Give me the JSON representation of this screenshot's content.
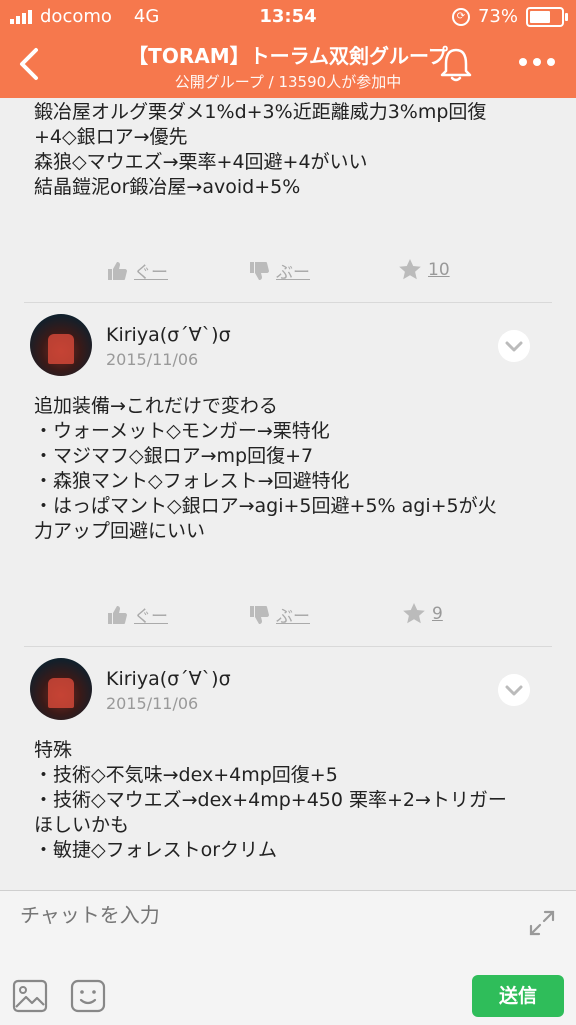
{
  "status_bar": {
    "carrier": "docomo",
    "network": "4G",
    "time": "13:54",
    "battery": "73%",
    "battery_level": 0.73
  },
  "header": {
    "title": "【TORAM】トーラム双剣グループ",
    "subtitle": "公開グループ / 13590人が参加中",
    "background": "#f6784d"
  },
  "posts": [
    {
      "text": "鍛冶屋オルグ栗ダメ1%d+3%近距離威力3%mp回復\n+4◇銀ロア→優先\n森狼◇マウエズ→栗率+4回避+4がいい\n結晶鎧泥or鍛冶屋→avoid+5%",
      "like_label": "ぐー",
      "dislike_label": "ぶー",
      "star_count": "10"
    },
    {
      "author": "Kiriya(σ´∀`)σ",
      "date": "2015/11/06",
      "text": "追加装備→これだけで変わる\n・ウォーメット◇モンガー→栗特化\n・マジマフ◇銀ロア→mp回復+7\n・森狼マント◇フォレスト→回避特化\n・はっぱマント◇銀ロア→agi+5回避+5% agi+5が火\n力アップ回避にいい",
      "like_label": "ぐー",
      "dislike_label": "ぶー",
      "star_count": "9"
    },
    {
      "author": "Kiriya(σ´∀`)σ",
      "date": "2015/11/06",
      "text": "特殊\n・技術◇不気味→dex+4mp回復+5\n・技術◇マウエズ→dex+4mp+450 栗率+2→トリガー\nほしいかも\n・敏捷◇フォレストorクリム"
    }
  ],
  "input": {
    "placeholder": "チャットを入力",
    "send_label": "送信",
    "send_color": "#2fbd5a"
  },
  "icons": [
    "back-icon",
    "bell-icon",
    "more-icon",
    "chevron-down-icon",
    "thumbs-up-icon",
    "thumbs-down-icon",
    "star-icon",
    "expand-icon",
    "image-icon",
    "emoji-icon"
  ]
}
